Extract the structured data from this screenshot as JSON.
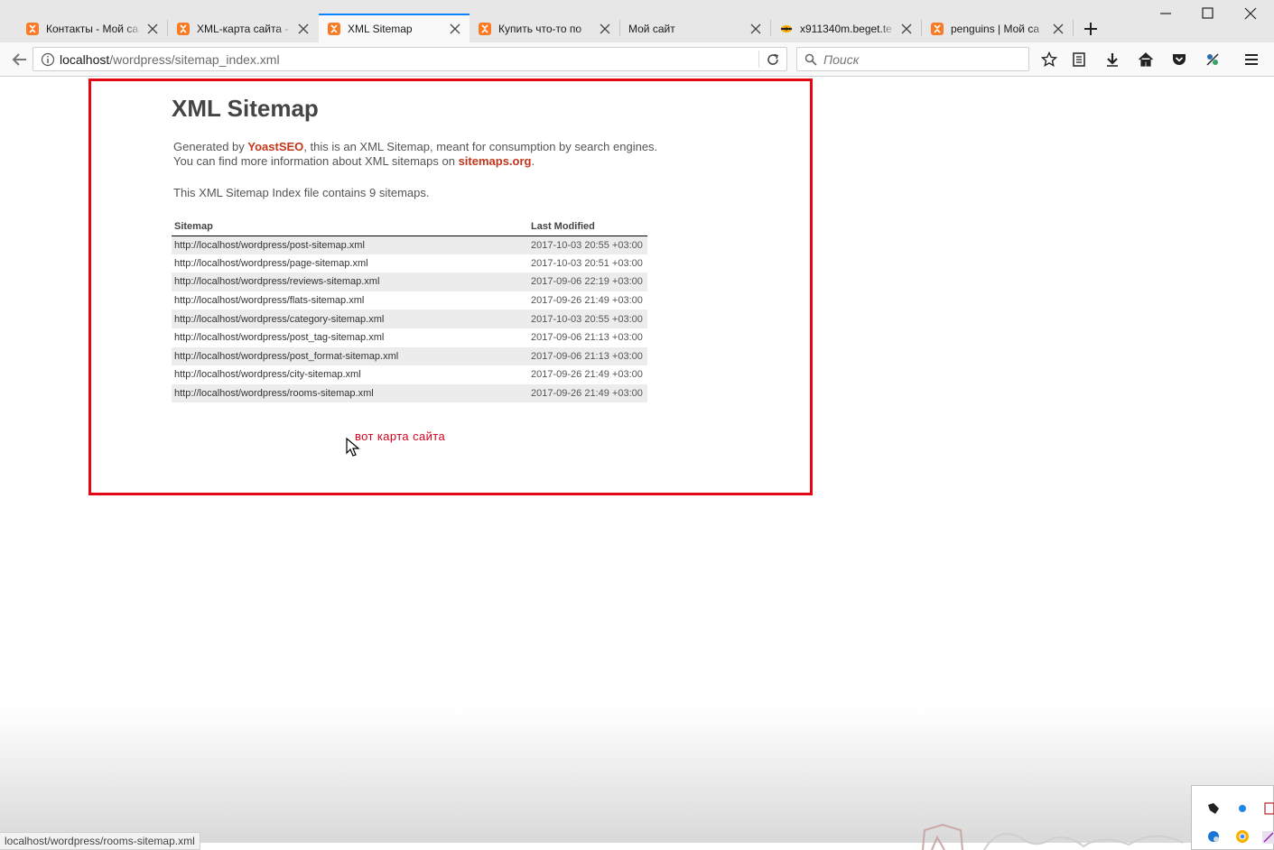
{
  "browser": {
    "tabs": [
      {
        "title": "Контакты - Мой са",
        "active": false
      },
      {
        "title": "XML-карта сайта -",
        "active": false
      },
      {
        "title": "XML Sitemap",
        "active": true
      },
      {
        "title": "Купить что-то по",
        "active": false
      },
      {
        "title": "Мой сайт",
        "active": false
      },
      {
        "title": "x911340m.beget.te",
        "active": false
      },
      {
        "title": "penguins | Мой са",
        "active": false
      }
    ],
    "url_host": "localhost",
    "url_path": "/wordpress/sitemap_index.xml",
    "search_placeholder": "Поиск"
  },
  "page": {
    "title": "XML Sitemap",
    "intro_1_pre": "Generated by ",
    "intro_1_link": "YoastSEO",
    "intro_1_post": ", this is an XML Sitemap, meant for consumption by search engines.",
    "intro_2_pre": "You can find more information about XML sitemaps on ",
    "intro_2_link": "sitemaps.org",
    "intro_2_post": ".",
    "count_text": "This XML Sitemap Index file contains 9 sitemaps.",
    "table": {
      "headers": [
        "Sitemap",
        "Last Modified"
      ],
      "rows": [
        [
          "http://localhost/wordpress/post-sitemap.xml",
          "2017-10-03 20:55 +03:00"
        ],
        [
          "http://localhost/wordpress/page-sitemap.xml",
          "2017-10-03 20:51 +03:00"
        ],
        [
          "http://localhost/wordpress/reviews-sitemap.xml",
          "2017-09-06 22:19 +03:00"
        ],
        [
          "http://localhost/wordpress/flats-sitemap.xml",
          "2017-09-26 21:49 +03:00"
        ],
        [
          "http://localhost/wordpress/category-sitemap.xml",
          "2017-10-03 20:55 +03:00"
        ],
        [
          "http://localhost/wordpress/post_tag-sitemap.xml",
          "2017-09-06 21:13 +03:00"
        ],
        [
          "http://localhost/wordpress/post_format-sitemap.xml",
          "2017-09-06 21:13 +03:00"
        ],
        [
          "http://localhost/wordpress/city-sitemap.xml",
          "2017-09-26 21:49 +03:00"
        ],
        [
          "http://localhost/wordpress/rooms-sitemap.xml",
          "2017-09-26 21:49 +03:00"
        ]
      ]
    }
  },
  "annotation": {
    "text": "вот карта сайта",
    "color": "#d6001c"
  },
  "status_bar": {
    "text": "localhost/wordpress/rooms-sitemap.xml"
  },
  "colors": {
    "highlight_frame": "#e30613",
    "link": "#c3361b",
    "active_tab_accent": "#0a84ff"
  }
}
